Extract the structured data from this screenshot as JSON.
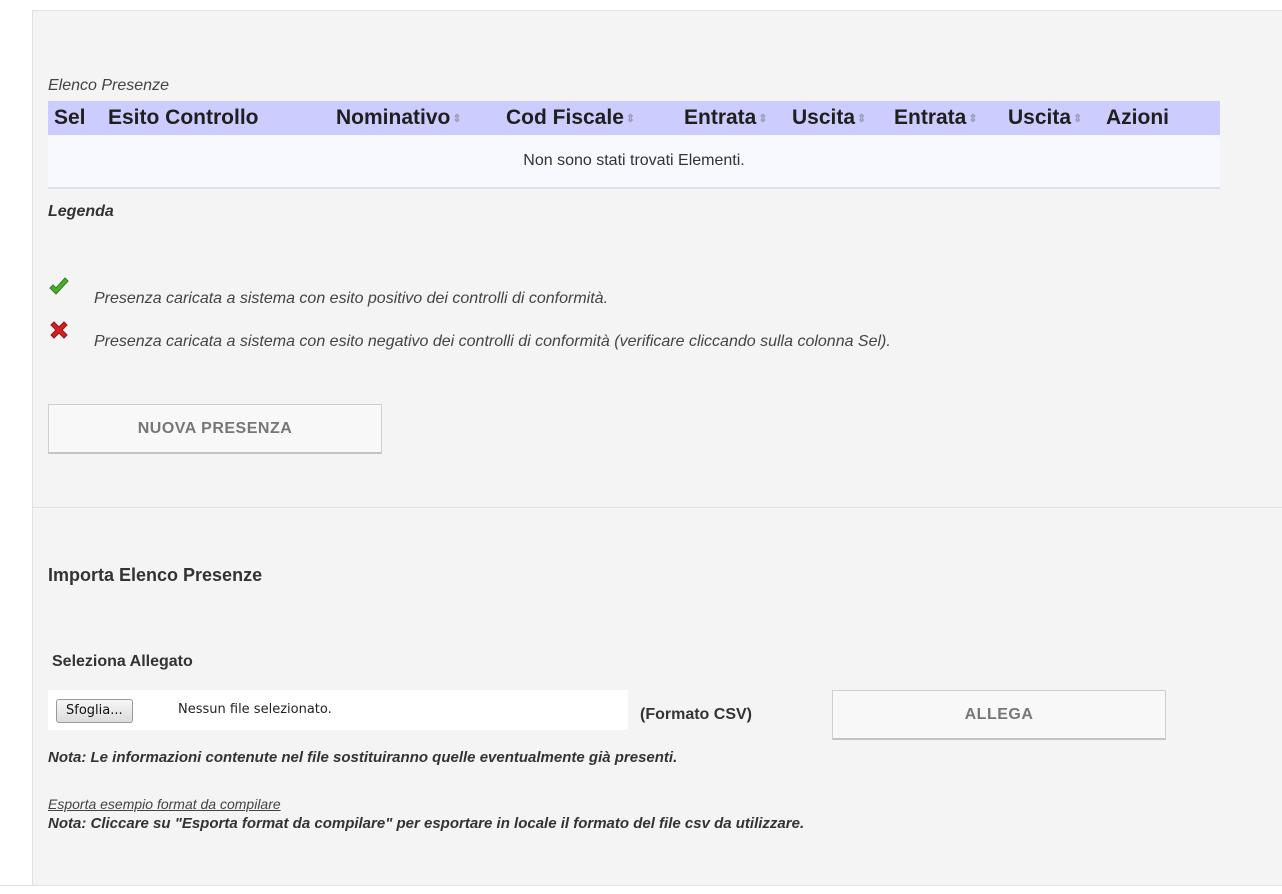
{
  "presenze": {
    "caption": "Elenco Presenze",
    "columns": [
      {
        "label": "Sel",
        "sortable": false
      },
      {
        "label": "Esito Controllo",
        "sortable": false
      },
      {
        "label": "Nominativo",
        "sortable": true
      },
      {
        "label": "Cod Fiscale",
        "sortable": true
      },
      {
        "label": "Entrata",
        "sortable": true
      },
      {
        "label": "Uscita",
        "sortable": true
      },
      {
        "label": "Entrata",
        "sortable": true
      },
      {
        "label": "Uscita",
        "sortable": true
      },
      {
        "label": "Azioni",
        "sortable": false
      }
    ],
    "empty_message": "Non sono stati trovati Elementi."
  },
  "legend": {
    "title": "Legenda",
    "items": [
      {
        "icon": "green-check-icon",
        "text": "Presenza caricata a sistema con esito positivo dei controlli di conformità.",
        "color": "#4caf2a"
      },
      {
        "icon": "red-x-icon",
        "text": "Presenza caricata a sistema con esito negativo dei controlli di conformità (verificare cliccando sulla colonna Sel).",
        "color": "#d42020"
      }
    ]
  },
  "new_button_label": "NUOVA PRESENZA",
  "import": {
    "title": "Importa Elenco Presenze",
    "attachment_label": "Seleziona Allegato",
    "browse_label": "Sfoglia...",
    "file_status": "Nessun file selezionato.",
    "format_label": "(Formato CSV)",
    "attach_button_label": "ALLEGA",
    "note_replace": "Nota: Le informazioni contenute nel file sostituiranno quelle eventualmente già presenti.",
    "export_link": "Esporta esempio format da compilare",
    "note_export": "Nota: Cliccare su \"Esporta format da compilare\" per esportare in locale il formato del file csv da utilizzare."
  },
  "colors": {
    "header_bg": "#ccccff",
    "panel_bg": "#f4f4f4"
  }
}
